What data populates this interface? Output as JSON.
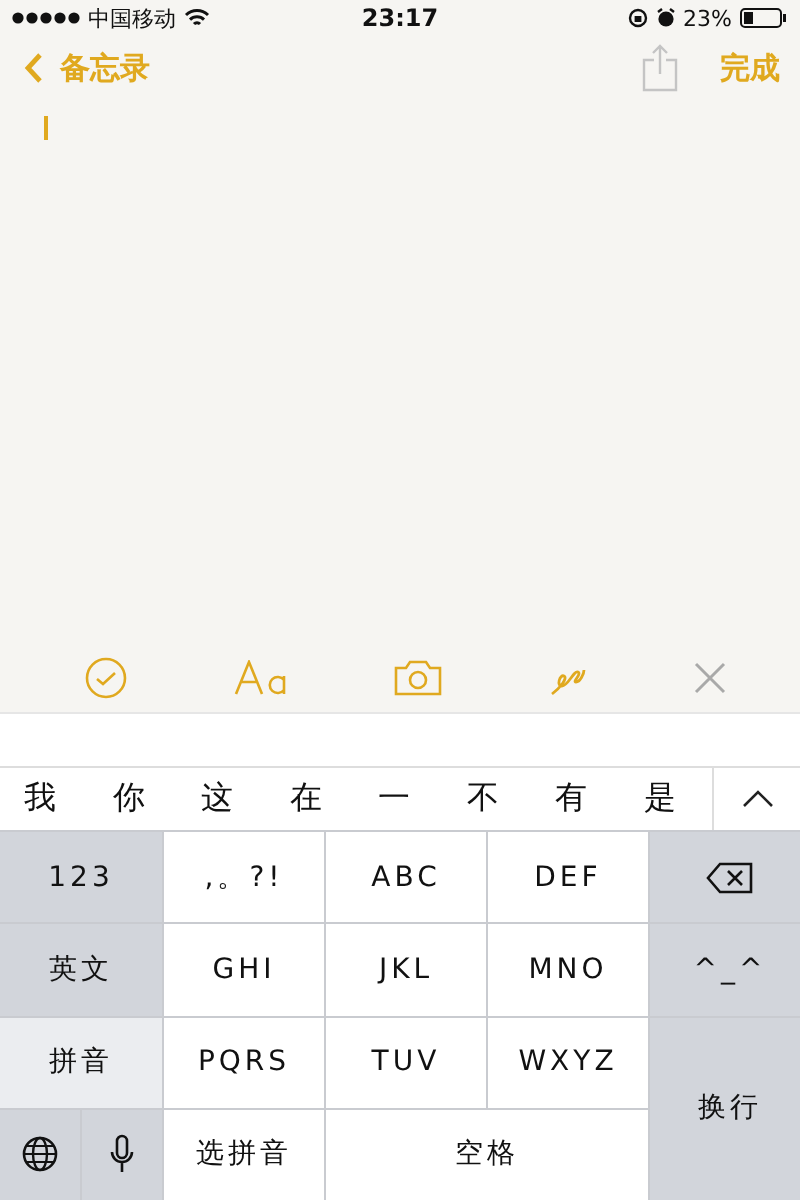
{
  "status_bar": {
    "carrier": "中国移动",
    "time": "23:17",
    "battery": "23%"
  },
  "nav": {
    "back": "备忘录",
    "done": "完成"
  },
  "candidates": [
    "我",
    "你",
    "这",
    "在",
    "一",
    "不",
    "有",
    "是"
  ],
  "keys": [
    {
      "kind": "function",
      "label": "123"
    },
    {
      "kind": "letter",
      "label": ",。?!"
    },
    {
      "kind": "letter",
      "label": "ABC"
    },
    {
      "kind": "letter",
      "label": "DEF"
    },
    {
      "kind": "backspace"
    },
    {
      "kind": "mode",
      "label": "英文",
      "selected": false
    },
    {
      "kind": "letter",
      "label": "GHI"
    },
    {
      "kind": "letter",
      "label": "JKL"
    },
    {
      "kind": "letter",
      "label": "MNO"
    },
    {
      "kind": "function",
      "label": "^_^"
    },
    {
      "kind": "mode",
      "label": "拼音",
      "selected": true
    },
    {
      "kind": "letter",
      "label": "PQRS"
    },
    {
      "kind": "letter",
      "label": "TUV"
    },
    {
      "kind": "letter",
      "label": "WXYZ"
    },
    {
      "kind": "function",
      "label": "换行"
    },
    {
      "kind": "globe"
    },
    {
      "kind": "mic"
    },
    {
      "kind": "letter",
      "label": "选拼音"
    },
    {
      "kind": "letter",
      "label": "空格"
    }
  ]
}
